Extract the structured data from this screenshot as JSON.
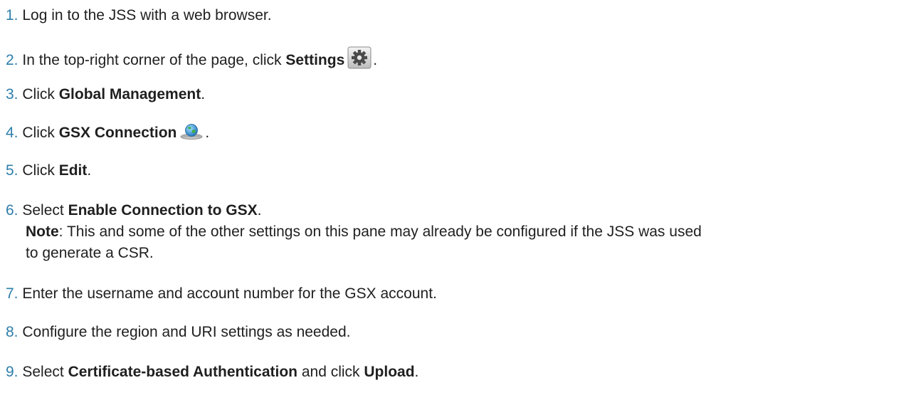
{
  "steps": [
    {
      "num": "1.",
      "text": "Log in to the JSS with a web browser."
    },
    {
      "num": "2.",
      "pre": "In the top-right corner of the page, click ",
      "bold": "Settings",
      "icon": "gear-icon",
      "post": "."
    },
    {
      "num": "3.",
      "pre": "Click ",
      "bold": "Global Management",
      "post": "."
    },
    {
      "num": "4.",
      "pre": "Click ",
      "bold": "GSX Connection",
      "icon": "globe-wrench-icon",
      "post": "."
    },
    {
      "num": "5.",
      "pre": "Click ",
      "bold": "Edit",
      "post": "."
    },
    {
      "num": "6.",
      "pre": "Select ",
      "bold": "Enable Connection to GSX",
      "post": ".",
      "note_label": "Note",
      "note_text_1": ": This and some of the other settings on this pane may already be configured if the JSS was used",
      "note_text_2": "to generate a CSR."
    },
    {
      "num": "7.",
      "text": "Enter the username and account number for the GSX account."
    },
    {
      "num": "8.",
      "text": "Configure the region and URI settings as needed."
    },
    {
      "num": "9.",
      "pre": "Select ",
      "bold": "Certificate-based Authentication",
      "mid": " and click ",
      "bold2": "Upload",
      "post": "."
    }
  ],
  "colors": {
    "step_number": "#2e7eab",
    "text": "#1f1f1f"
  }
}
